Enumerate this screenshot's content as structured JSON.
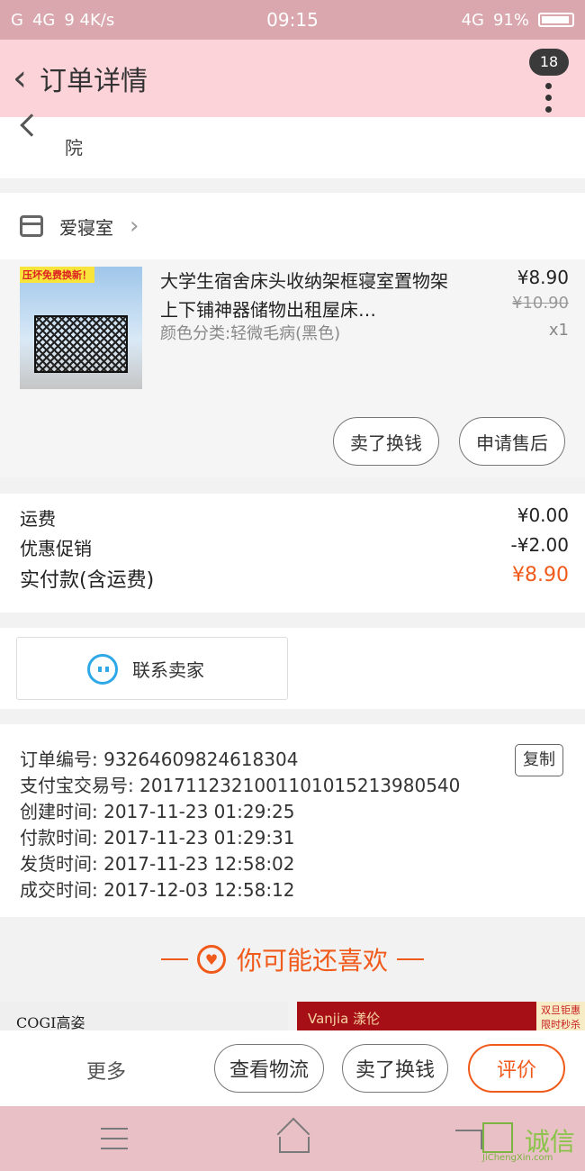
{
  "status_bar": {
    "carrier1": "G",
    "net1": "4G",
    "speed": "9 4K/s",
    "time": "09:15",
    "net2": "4G",
    "battery": "91%"
  },
  "header": {
    "title": "订单详情",
    "badge_count": "18"
  },
  "address": {
    "line": "院"
  },
  "shop": {
    "name": "爱寝室"
  },
  "product": {
    "image_tag": "压坏免费换新！",
    "title": "大学生宿舍床头收纳架框寝室置物架上下铺神器储物出租屋床…",
    "spec": "颜色分类:轻微毛病(黑色)",
    "price": "¥8.90",
    "original_price": "¥10.90",
    "quantity": "x1",
    "sell_label": "卖了换钱",
    "aftersale_label": "申请售后"
  },
  "fees": {
    "shipping_label": "运费",
    "shipping_value": "¥0.00",
    "promo_label": "优惠促销",
    "promo_value": "-¥2.00",
    "total_label": "实付款(含运费)",
    "total_value": "¥8.90"
  },
  "contact": {
    "label": "联系卖家"
  },
  "order_info": {
    "order_no": "订单编号: 93264609824618304",
    "alipay_no": "支付宝交易号: 2017112321001101015213980540",
    "created": "创建时间: 2017-11-23  01:29:25",
    "paid": "付款时间: 2017-11-23  01:29:31",
    "shipped": "发货时间: 2017-11-23  12:58:02",
    "completed": "成交时间: 2017-12-03  12:58:12",
    "copy_label": "复制"
  },
  "recommend": {
    "title": "你可能还喜欢"
  },
  "ads": {
    "left_brand": "COGI高姿",
    "right_brand": "Vanjia 漾伦",
    "right_tag": "双旦钜惠 限时秒杀"
  },
  "actions": {
    "more": "更多",
    "logistics": "查看物流",
    "sell": "卖了换钱",
    "review": "评价"
  },
  "watermark": {
    "text": "诚信",
    "url": "JiChengXin.com"
  },
  "colors": {
    "accent": "#f05a1a",
    "header_bg": "#fdd3da",
    "status_bg": "#d9a7ad"
  }
}
